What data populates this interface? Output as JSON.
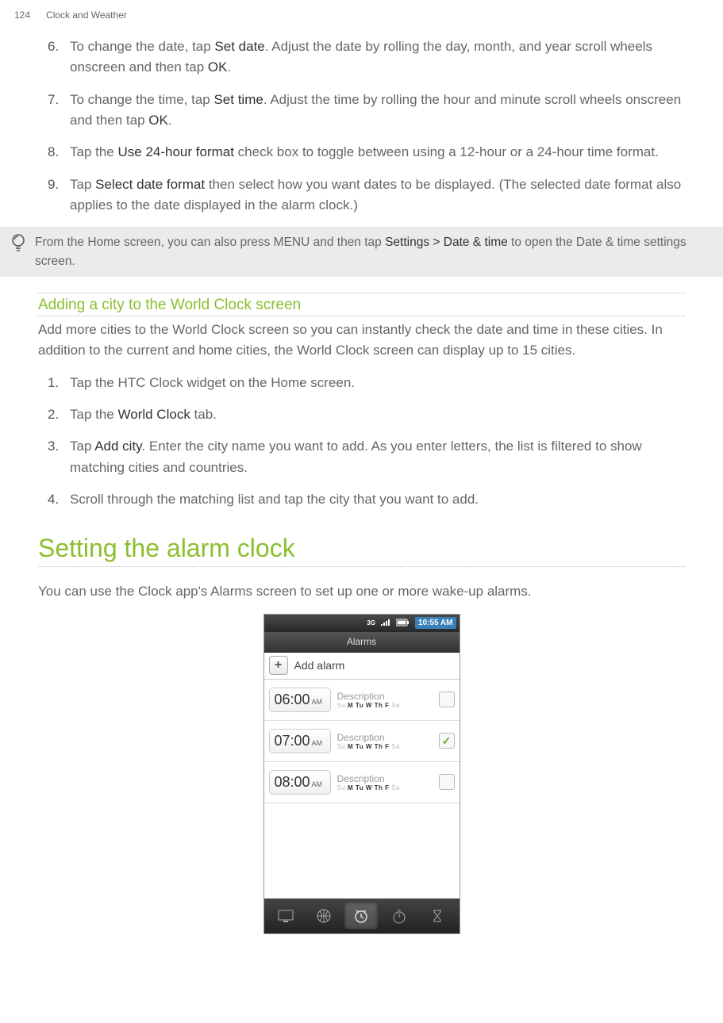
{
  "header": {
    "page_number": "124",
    "chapter": "Clock and Weather"
  },
  "steps_a": {
    "6": {
      "pre": "To change the date, tap ",
      "bold1": "Set date",
      "mid": ". Adjust the date by rolling the day, month, and year scroll wheels onscreen and then tap ",
      "bold2": "OK",
      "post": "."
    },
    "7": {
      "pre": "To change the time, tap ",
      "bold1": "Set time",
      "mid": ". Adjust the time by rolling the hour and minute scroll wheels onscreen and then tap ",
      "bold2": "OK",
      "post": "."
    },
    "8": {
      "pre": "Tap the ",
      "bold1": "Use 24-hour format",
      "post": " check box to toggle between using a 12-hour or a 24-hour time format."
    },
    "9": {
      "pre": "Tap ",
      "bold1": "Select date format",
      "post": " then select how you want dates to be displayed. (The selected date format also applies to the date displayed in the alarm clock.)"
    }
  },
  "tip": {
    "pre": "From the Home screen, you can also press MENU and then tap ",
    "bold": "Settings > Date & time",
    "post": " to open the Date & time settings screen."
  },
  "subsection": {
    "title": "Adding a city to the World Clock screen",
    "intro": "Add more cities to the World Clock screen so you can instantly check the date and time in these cities. In addition to the current and home cities, the World Clock screen can display up to 15 cities."
  },
  "steps_b": {
    "1": "Tap the HTC Clock widget on the Home screen.",
    "2": {
      "pre": "Tap the ",
      "bold": "World Clock",
      "post": " tab."
    },
    "3": {
      "pre": "Tap ",
      "bold": "Add city",
      "post": ". Enter the city name you want to add. As you enter letters, the list is filtered to show matching cities and countries."
    },
    "4": "Scroll through the matching list and tap the city that you want to add."
  },
  "section": {
    "title": "Setting the alarm clock",
    "intro": "You can use the Clock app's Alarms screen to set up one or more wake-up alarms."
  },
  "phone": {
    "status": {
      "network": "3G",
      "time": "10:55 AM"
    },
    "screen_title": "Alarms",
    "add_alarm": "Add alarm",
    "alarms": [
      {
        "time": "06:00",
        "ampm": "AM",
        "desc": "Description",
        "days_inactive_pre": "Su",
        "days_active": "M Tu W Th F",
        "days_inactive_post": "Sa",
        "checked": false
      },
      {
        "time": "07:00",
        "ampm": "AM",
        "desc": "Description",
        "days_inactive_pre": "Su",
        "days_active": "M Tu W Th F",
        "days_inactive_post": "Sa",
        "checked": true
      },
      {
        "time": "08:00",
        "ampm": "AM",
        "desc": "Description",
        "days_inactive_pre": "Su",
        "days_active": "M Tu W Th F",
        "days_inactive_post": "Sa",
        "checked": false
      }
    ]
  }
}
